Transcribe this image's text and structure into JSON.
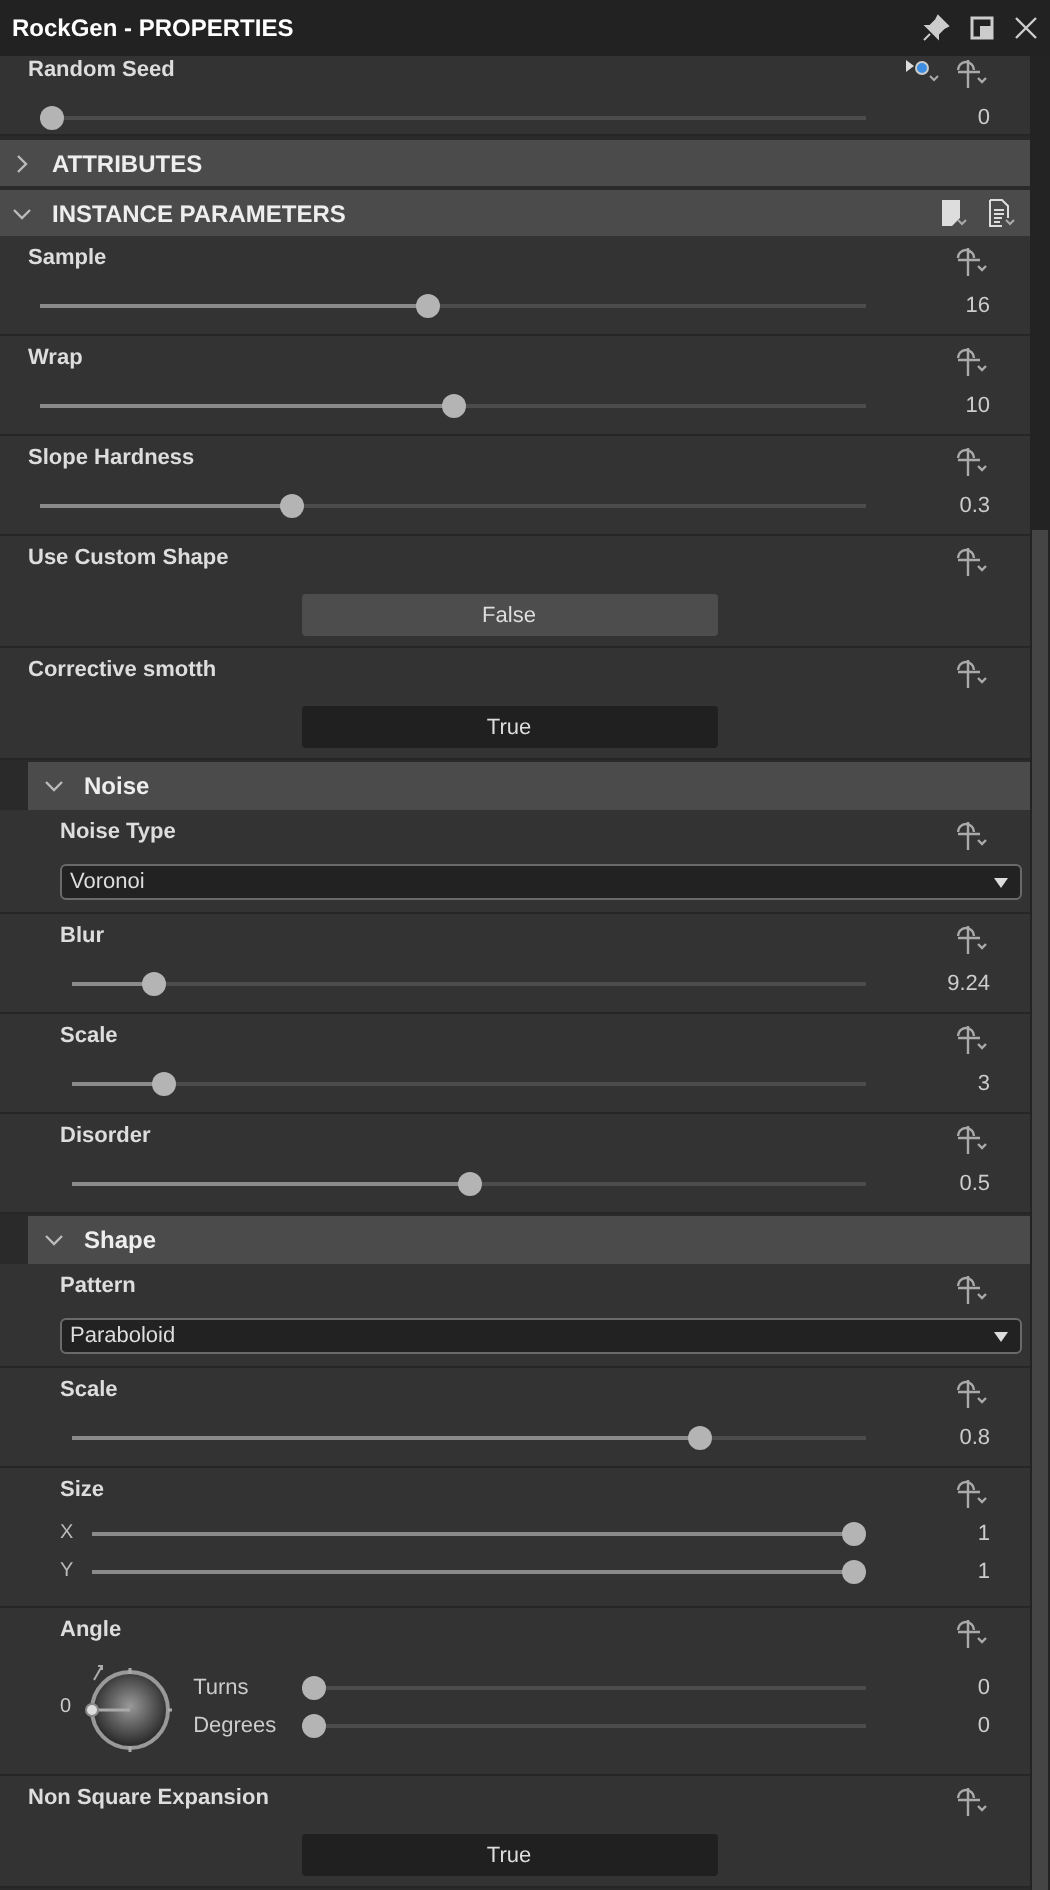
{
  "window": {
    "title": "RockGen - PROPERTIES"
  },
  "top_param": {
    "label": "Random Seed",
    "level": 0,
    "value": "0"
  },
  "sections": [
    {
      "title": "ATTRIBUTES",
      "expanded": false
    },
    {
      "title": "INSTANCE PARAMETERS",
      "expanded": true,
      "items": [
        {
          "kind": "slider",
          "label": "Sample",
          "level": 0.47,
          "value": "16"
        },
        {
          "kind": "slider",
          "label": "Wrap",
          "level": 0.5,
          "value": "10"
        },
        {
          "kind": "slider",
          "label": "Slope Hardness",
          "level": 0.3,
          "value": "0.3"
        },
        {
          "kind": "toggle",
          "label": "Use Custom Shape",
          "on": false,
          "value": "False"
        },
        {
          "kind": "toggle",
          "label": "Corrective smotth",
          "on": true,
          "value": "True"
        },
        {
          "kind": "group",
          "title": "Noise",
          "expanded": true,
          "items": [
            {
              "kind": "dropdown",
              "label": "Noise Type",
              "value": "Voronoi"
            },
            {
              "kind": "slider",
              "label": "Blur",
              "level": 0.09,
              "value": "9.24"
            },
            {
              "kind": "slider",
              "label": "Scale",
              "level": 0.105,
              "value": "3"
            },
            {
              "kind": "slider",
              "label": "Disorder",
              "level": 0.5,
              "value": "0.5"
            }
          ]
        },
        {
          "kind": "group",
          "title": "Shape",
          "expanded": true,
          "items": [
            {
              "kind": "dropdown",
              "label": "Pattern",
              "value": "Paraboloid"
            },
            {
              "kind": "slider",
              "label": "Scale",
              "level": 0.8,
              "value": "0.8"
            },
            {
              "kind": "vector",
              "label": "Size",
              "rows": [
                {
                  "label": "X",
                  "level": 1,
                  "value": "1"
                },
                {
                  "label": "Y",
                  "level": 1,
                  "value": "1"
                }
              ]
            },
            {
              "kind": "angle",
              "label": "Angle",
              "dial_value": "0",
              "rows": [
                {
                  "label": "Turns",
                  "level": 0,
                  "value": "0"
                },
                {
                  "label": "Degrees",
                  "level": 0,
                  "value": "0"
                }
              ]
            }
          ]
        },
        {
          "kind": "toggle",
          "label": "Non Square Expansion",
          "on": true,
          "value": "True"
        }
      ]
    }
  ]
}
